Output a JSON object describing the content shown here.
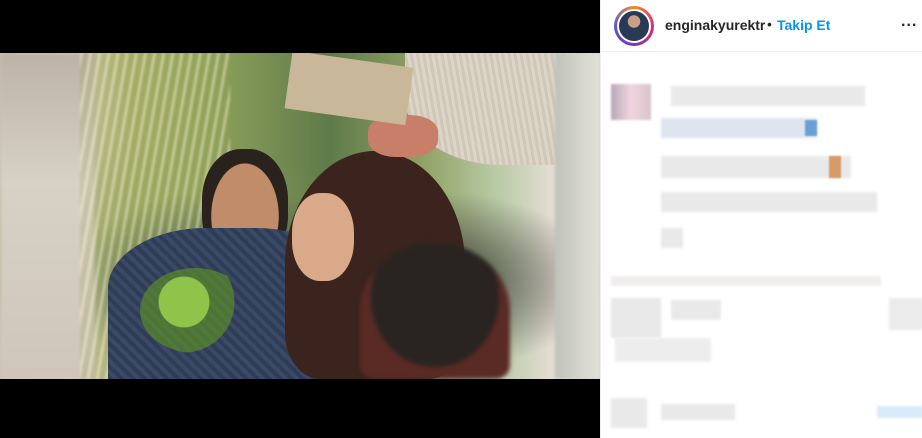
{
  "post": {
    "username": "enginakyurektr",
    "separator": "•",
    "follow_label": "Takip Et",
    "more_label": "...",
    "more_icon": "ellipsis-icon"
  },
  "colors": {
    "follow_blue": "#0095f6",
    "text_dark": "#262626",
    "divider": "#efefef",
    "photo_letterbox": "#000000"
  }
}
